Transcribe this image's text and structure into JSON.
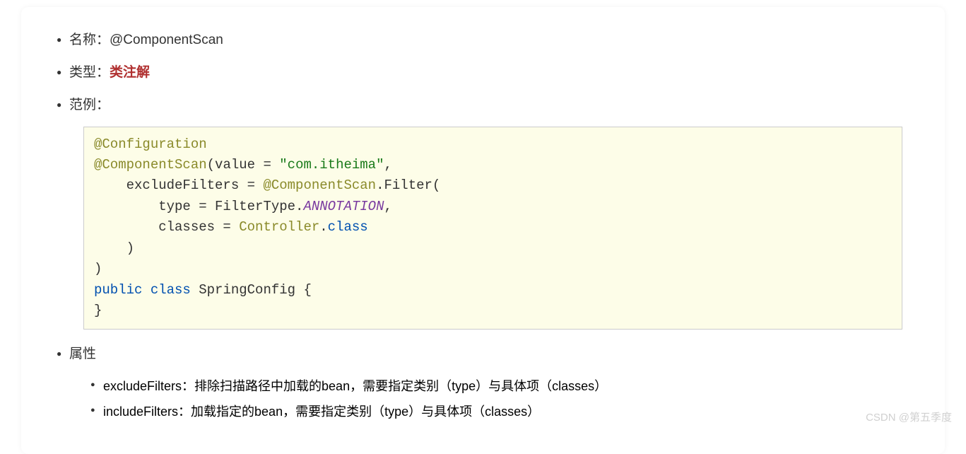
{
  "items": {
    "name": {
      "label": "名称：",
      "value": "@ComponentScan"
    },
    "type": {
      "label": "类型：",
      "value": "类注解"
    },
    "example": {
      "label": "范例："
    },
    "properties": {
      "label": "属性"
    }
  },
  "code": {
    "t1": "@Configuration",
    "t2": "@ComponentScan",
    "t3": "(value = ",
    "t4": "\"com.itheima\"",
    "t5": ",",
    "t6": "    excludeFilters = ",
    "t7": "@ComponentScan",
    "t8": ".Filter(",
    "t9": "        type = FilterType.",
    "t10": "ANNOTATION",
    "t11": ",",
    "t12": "        classes = ",
    "t13": "Controller",
    "t14": ".",
    "t15": "class",
    "t16": "    )",
    "t17": ")",
    "t18": "public",
    "t19": " ",
    "t20": "class",
    "t21": " SpringConfig {",
    "t22": "}"
  },
  "sub": {
    "s1": "excludeFilters：排除扫描路径中加载的bean，需要指定类别（type）与具体项（classes）",
    "s2": "includeFilters：加载指定的bean，需要指定类别（type）与具体项（classes）"
  },
  "watermark": "CSDN @第五季度"
}
